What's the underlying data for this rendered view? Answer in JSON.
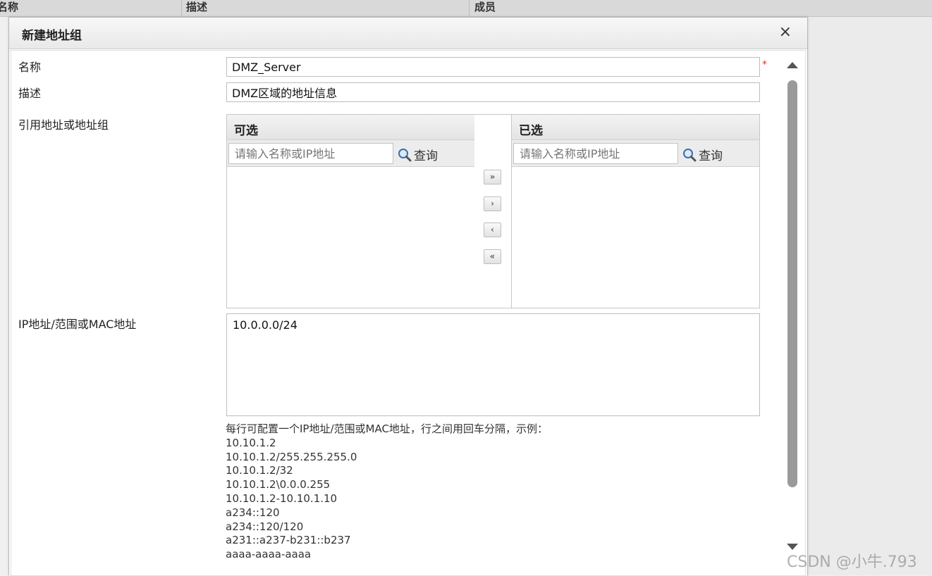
{
  "background_table": {
    "columns": [
      "名称",
      "描述",
      "成员"
    ]
  },
  "dialog": {
    "title": "新建地址组",
    "close_label": "×"
  },
  "form": {
    "name_label": "名称",
    "name_value": "DMZ_Server",
    "required_mark": "*",
    "desc_label": "描述",
    "desc_value": "DMZ区域的地址信息",
    "ref_label": "引用地址或地址组",
    "ip_label": "IP地址/范围或MAC地址",
    "ip_value": "10.0.0.0/24"
  },
  "available_panel": {
    "title": "可选",
    "search_placeholder": "请输入名称或IP地址",
    "search_button": "查询"
  },
  "selected_panel": {
    "title": "已选",
    "search_placeholder": "请输入名称或IP地址",
    "search_button": "查询"
  },
  "move_buttons": {
    "add_all": "»",
    "add": "›",
    "remove": "‹",
    "remove_all": "«"
  },
  "hint": {
    "intro": "每行可配置一个IP地址/范围或MAC地址，行之间用回车分隔，示例：",
    "examples": [
      "10.10.1.2",
      "10.10.1.2/255.255.255.0",
      "10.10.1.2/32",
      "10.10.1.2\\0.0.0.255",
      "10.10.1.2-10.10.1.10",
      "a234::120",
      "a234::120/120",
      "a231::a237-b231::b237",
      "aaaa-aaaa-aaaa"
    ]
  },
  "watermark": "CSDN @小牛.793"
}
